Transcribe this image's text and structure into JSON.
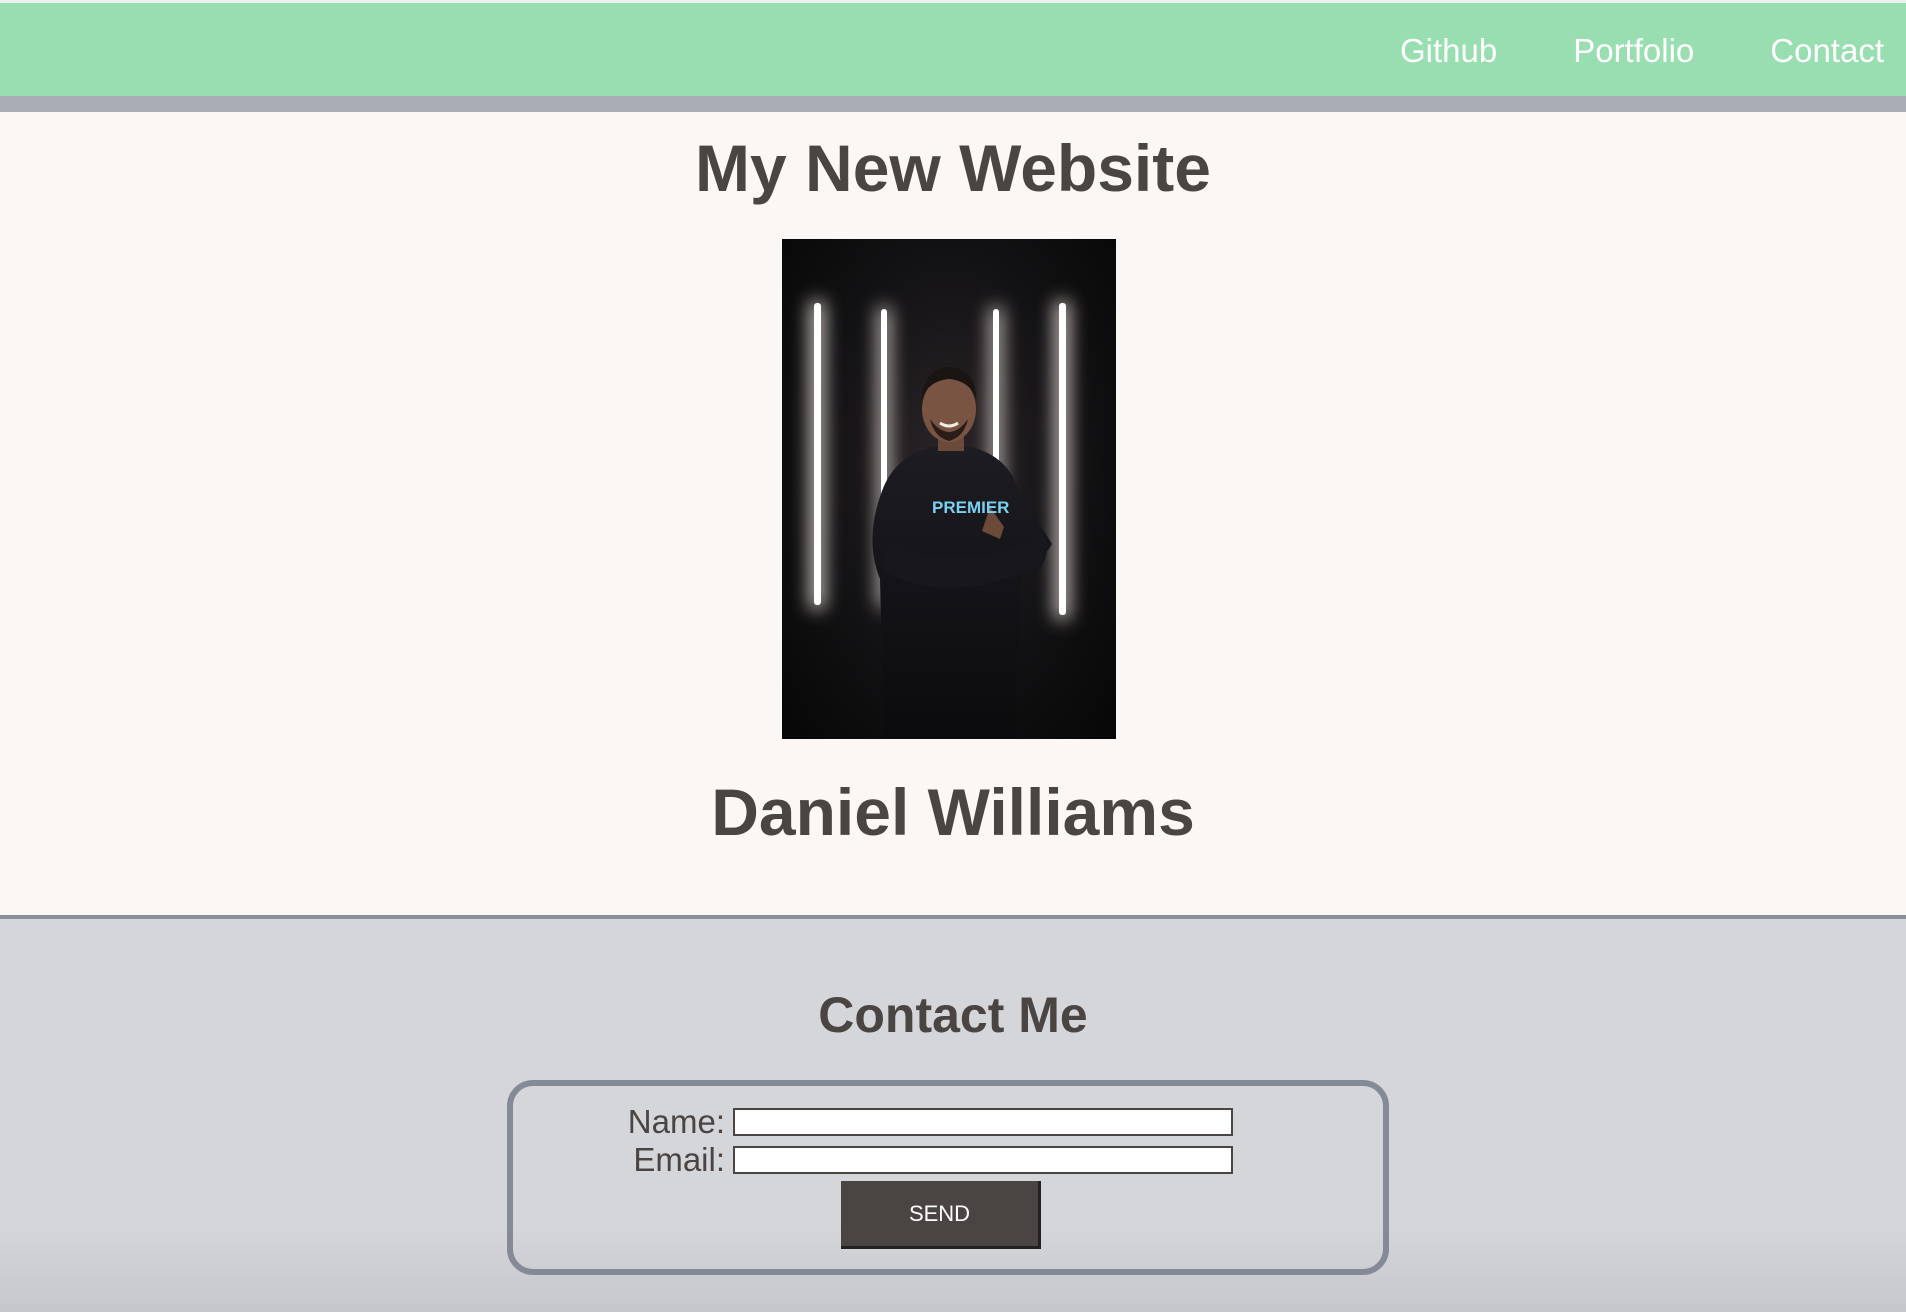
{
  "nav": {
    "links": [
      {
        "label": "Github"
      },
      {
        "label": "Portfolio"
      },
      {
        "label": "Contact"
      }
    ]
  },
  "hero": {
    "title": "My New Website",
    "name": "Daniel Williams",
    "photo_shirt_text": "PREMIER"
  },
  "contact": {
    "title": "Contact Me",
    "name_label": "Name:",
    "email_label": "Email:",
    "name_value": "",
    "email_value": "",
    "send_label": "SEND"
  },
  "colors": {
    "topbar": "#99deb0",
    "topbar_strip": "#a9adb5",
    "page_bg": "#faf7f4",
    "contact_bg": "#d5d6da",
    "text": "#4a4542",
    "button_bg": "#4a4542"
  }
}
